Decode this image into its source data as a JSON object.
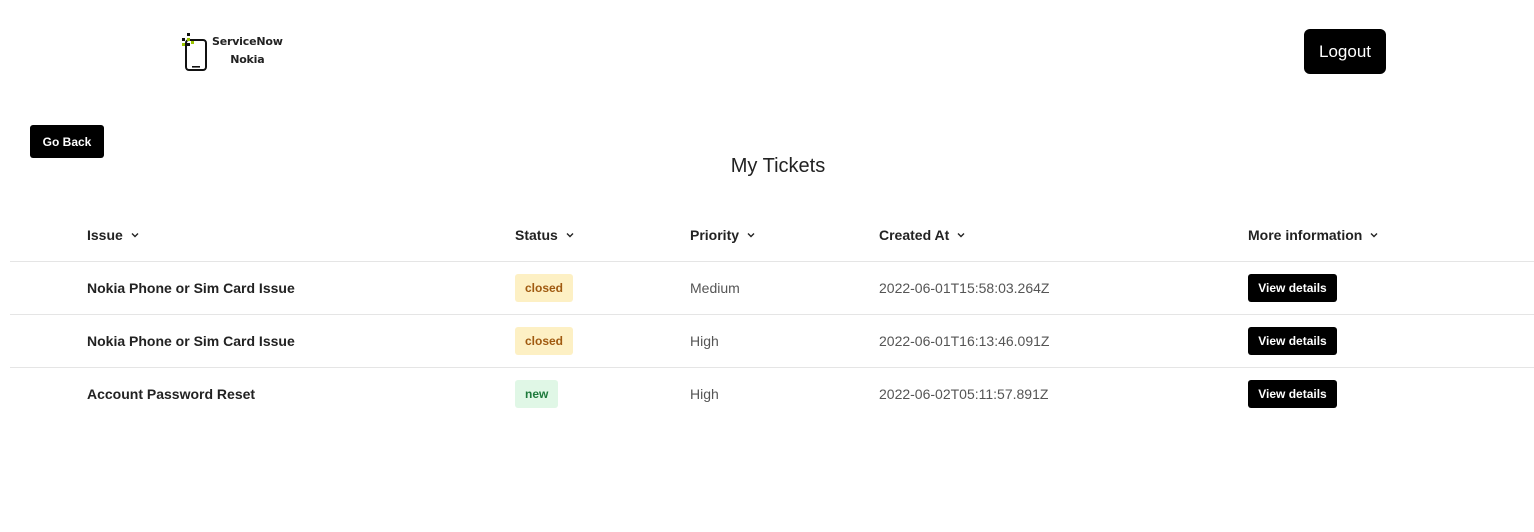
{
  "header": {
    "brand_line1": "ServiceNow",
    "brand_line2": "Nokia",
    "logout_label": "Logout"
  },
  "nav": {
    "go_back_label": "Go Back"
  },
  "page_title": "My Tickets",
  "table": {
    "columns": [
      "Issue",
      "Status",
      "Priority",
      "Created At",
      "More information"
    ],
    "rows": [
      {
        "issue": "Nokia Phone or Sim Card Issue",
        "status": "closed",
        "priority": "Medium",
        "created_at": "2022-06-01T15:58:03.264Z",
        "action": "View details"
      },
      {
        "issue": "Nokia Phone or Sim Card Issue",
        "status": "closed",
        "priority": "High",
        "created_at": "2022-06-01T16:13:46.091Z",
        "action": "View details"
      },
      {
        "issue": "Account Password Reset",
        "status": "new",
        "priority": "High",
        "created_at": "2022-06-02T05:11:57.891Z",
        "action": "View details"
      }
    ]
  },
  "colors": {
    "button_bg": "#000000",
    "closed_badge_bg": "#fdf0c4",
    "closed_badge_text": "#a05a10",
    "new_badge_bg": "#e0f7e6",
    "new_badge_text": "#1e7a3c",
    "logo_accent": "#9bc400"
  },
  "icons": {
    "logo": "phone-logo-icon",
    "sort": "chevron-down-icon"
  }
}
